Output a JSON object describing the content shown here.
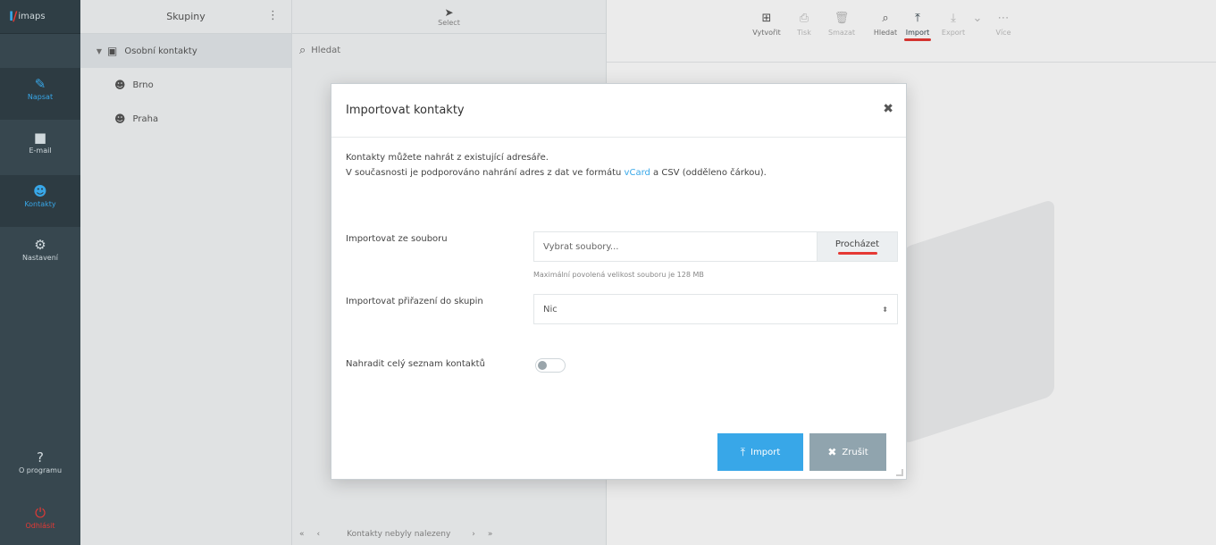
{
  "app": {
    "brand": "imaps"
  },
  "rail": {
    "items": [
      {
        "label": "Napsat",
        "icon": "compose-icon"
      },
      {
        "label": "E-mail",
        "icon": "mail-icon"
      },
      {
        "label": "Kontakty",
        "icon": "contacts-icon"
      },
      {
        "label": "Nastavení",
        "icon": "settings-icon"
      }
    ],
    "help": "O programu",
    "logout": "Odhlásit"
  },
  "groups": {
    "title": "Skupiny",
    "items": [
      {
        "label": "Osobní kontakty",
        "selected": true
      },
      {
        "label": "Brno"
      },
      {
        "label": "Praha"
      }
    ]
  },
  "list": {
    "select_label": "Select",
    "search_placeholder": "Hledat",
    "pager_text": "Kontakty nebyly nalezeny"
  },
  "toolbar": {
    "items": [
      {
        "label": "Vytvořit"
      },
      {
        "label": "Tisk"
      },
      {
        "label": "Smazat"
      },
      {
        "label": "Hledat"
      },
      {
        "label": "Import"
      },
      {
        "label": "Export"
      },
      {
        "label": "Více"
      }
    ]
  },
  "dialog": {
    "title": "Importovat kontakty",
    "intro_line1": "Kontakty můžete nahrát z existující adresáře.",
    "intro_line2_pre": "V současnosti je podporováno nahrání adres z dat ve formátu",
    "intro_link": "vCard",
    "intro_line2_post": "a CSV (odděleno čárkou).",
    "file_label": "Importovat ze souboru",
    "file_placeholder": "Vybrat soubory...",
    "browse_label": "Procházet",
    "file_hint": "Maximální povolená velikost souboru je 128 MB",
    "group_label": "Importovat přiřazení do skupin",
    "group_value": "Nic",
    "replace_label": "Nahradit celý seznam kontaktů",
    "import_button": "Import",
    "cancel_button": "Zrušit"
  }
}
